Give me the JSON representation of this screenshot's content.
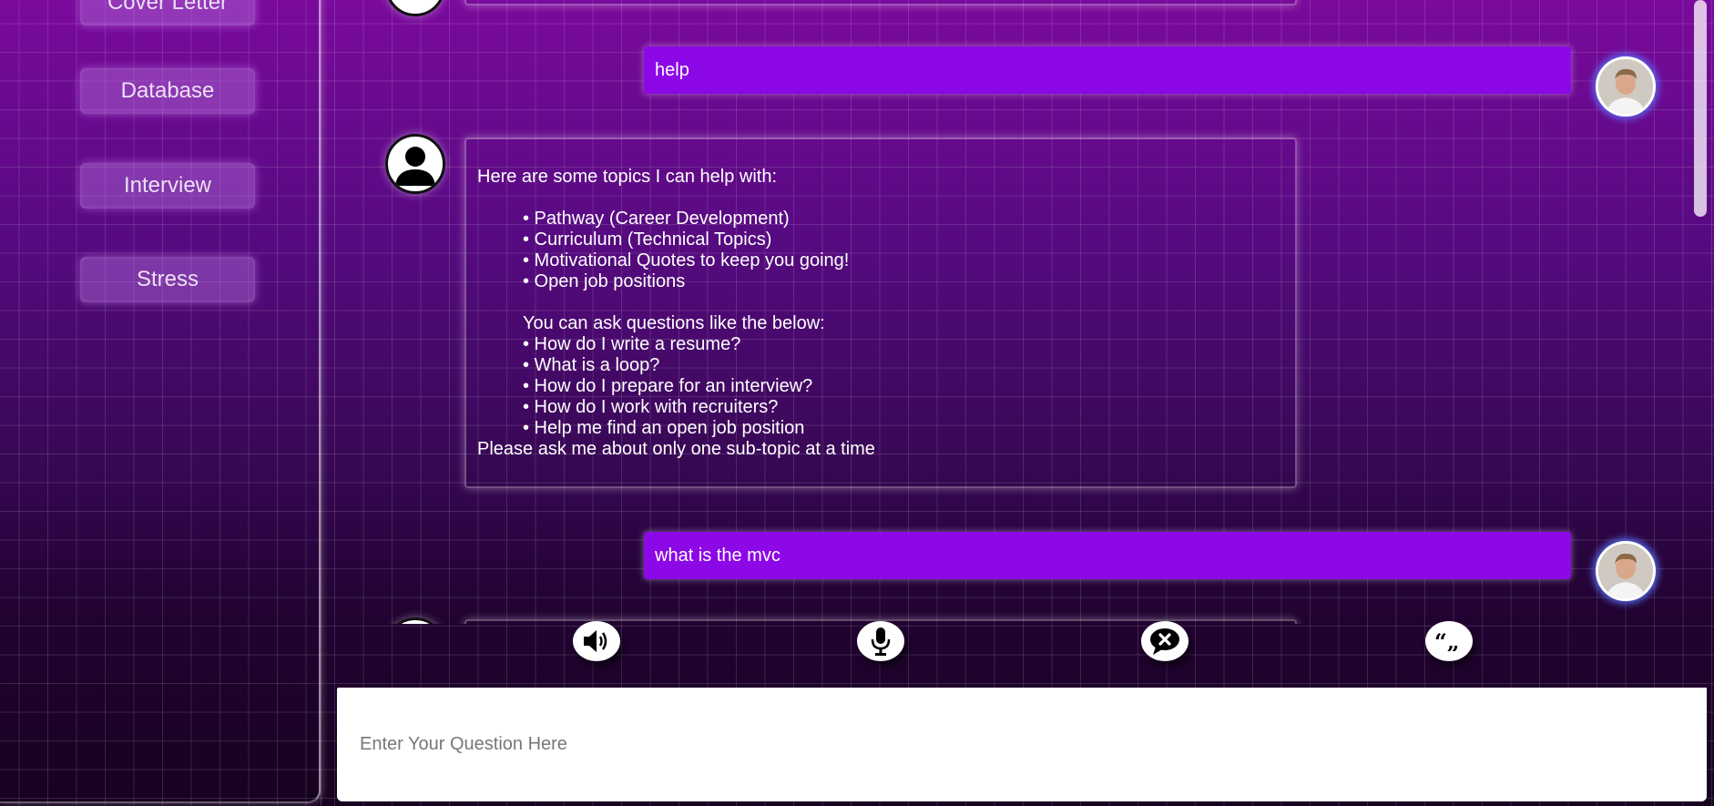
{
  "sidebar": {
    "items": [
      {
        "label": "Cover Letter"
      },
      {
        "label": "Database"
      },
      {
        "label": "Interview"
      },
      {
        "label": "Stress"
      }
    ]
  },
  "chat": {
    "messages": [
      {
        "role": "user",
        "text": "help"
      },
      {
        "role": "bot",
        "intro": "Here are some topics I can help with:",
        "topics": [
          "• Pathway (Career Development)",
          "• Curriculum (Technical Topics)",
          "• Motivational Quotes to keep you going!",
          "• Open job positions"
        ],
        "examples_intro": "You can ask questions like the below:",
        "examples": [
          "• How do I write a resume?",
          "• What is a loop?",
          "• How do I prepare for an interview?",
          "• How do I work with recruiters?",
          "• Help me find an open job position"
        ],
        "footer": "Please ask me about only one sub-topic at a time"
      },
      {
        "role": "user",
        "text": "what is the mvc"
      }
    ]
  },
  "controls": [
    {
      "icon": "speaker-icon"
    },
    {
      "icon": "microphone-icon"
    },
    {
      "icon": "clear-chat-icon"
    },
    {
      "icon": "quote-icon"
    }
  ],
  "input": {
    "placeholder": "Enter Your Question Here",
    "value": ""
  },
  "colors": {
    "user_bubble": "#8c08e6",
    "background_top": "#7a0a9c",
    "background_bottom": "#170220"
  }
}
